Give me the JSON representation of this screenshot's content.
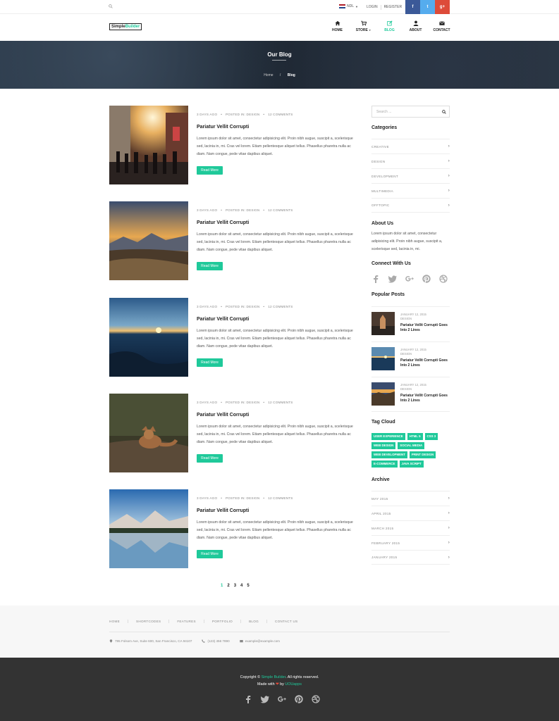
{
  "topbar": {
    "language": "NDL",
    "login": "LOGIN",
    "register": "REGISTER",
    "social": [
      "f",
      "t",
      "g+"
    ]
  },
  "logo": {
    "part1": "Simple",
    "part2": "Builder"
  },
  "menu": [
    {
      "label": "HOME",
      "icon": "home-icon"
    },
    {
      "label": "STORE",
      "icon": "cart-icon"
    },
    {
      "label": "BLOG",
      "icon": "edit-icon"
    },
    {
      "label": "ABOUT",
      "icon": "user-icon"
    },
    {
      "label": "CONTACT",
      "icon": "envelope-icon"
    }
  ],
  "hero": {
    "title": "Our Blog",
    "crumb_home": "Home",
    "crumb_current": "Blog",
    "crumb_sep": "/"
  },
  "posts": [
    {
      "date": "3 DAYS AGO",
      "category": "POSTED IN: DESIGN",
      "comments": "12 COMMENTS",
      "title": "Pariatur Vellit Corrupti",
      "excerpt": "Lorem ipsum dolor sit amet, consectetur adipisicing elit. Proin nibh augue, suscipit a, scelerisque sed, lacinia in, mi. Cras vel lorem. Etiam pellentesque aliquet tellus. Phasellus pharetra nulla ac diam. Nam congue, pede vitae dapibus aliquet.",
      "button": "Read More"
    },
    {
      "date": "3 DAYS AGO",
      "category": "POSTED IN: DESIGN",
      "comments": "12 COMMENTS",
      "title": "Pariatur Vellit Corrupti",
      "excerpt": "Lorem ipsum dolor sit amet, consectetur adipisicing elit. Proin nibh augue, suscipit a, scelerisque sed, lacinia in, mi. Cras vel lorem. Etiam pellentesque aliquet tellus. Phasellus pharetra nulla ac diam. Nam congue, pede vitae dapibus aliquet.",
      "button": "Read More"
    },
    {
      "date": "3 DAYS AGO",
      "category": "POSTED IN: DESIGN",
      "comments": "12 COMMENTS",
      "title": "Pariatur Vellit Corrupti",
      "excerpt": "Lorem ipsum dolor sit amet, consectetur adipisicing elit. Proin nibh augue, suscipit a, scelerisque sed, lacinia in, mi. Cras vel lorem. Etiam pellentesque aliquet tellus. Phasellus pharetra nulla ac diam. Nam congue, pede vitae dapibus aliquet.",
      "button": "Read More"
    },
    {
      "date": "3 DAYS AGO",
      "category": "POSTED IN: DESIGN",
      "comments": "12 COMMENTS",
      "title": "Pariatur Vellit Corrupti",
      "excerpt": "Lorem ipsum dolor sit amet, consectetur adipisicing elit. Proin nibh augue, suscipit a, scelerisque sed, lacinia in, mi. Cras vel lorem. Etiam pellentesque aliquet tellus. Phasellus pharetra nulla ac diam. Nam congue, pede vitae dapibus aliquet.",
      "button": "Read More"
    },
    {
      "date": "3 DAYS AGO",
      "category": "POSTED IN: DESIGN",
      "comments": "12 COMMENTS",
      "title": "Pariatur Vellit Corrupti",
      "excerpt": "Lorem ipsum dolor sit amet, consectetur adipisicing elit. Proin nibh augue, suscipit a, scelerisque sed, lacinia in, mi. Cras vel lorem. Etiam pellentesque aliquet tellus. Phasellus pharetra nulla ac diam. Nam congue, pede vitae dapibus aliquet.",
      "button": "Read More"
    }
  ],
  "pagination": [
    "1",
    "2",
    "3",
    "4",
    "5"
  ],
  "sidebar": {
    "search_placeholder": "Search ...",
    "categories_title": "Categories",
    "categories": [
      "CREATIVE",
      "DESIGN",
      "DEVELOPMENT",
      "MULTIMEDIA",
      "OFFTOPIC"
    ],
    "about_title": "About Us",
    "about_text": "Lorem ipsum dolor sit amet, consectetur adipisicing elit. Proin nibh augue, suscipit a, scelerisque sed, lacinia in, mi.",
    "connect_title": "Connect With Us",
    "popular_title": "Popular Posts",
    "popular": [
      {
        "date": "JANUARY 12, 2015",
        "category": "DESIGN",
        "title": "Pariatur Vellit Corrupti Goes Into 2 Lines"
      },
      {
        "date": "JANUARY 12, 2015",
        "category": "DESIGN",
        "title": "Pariatur Vellit Corrupti Goes Into 2 Lines"
      },
      {
        "date": "JANUARY 12, 2015",
        "category": "DESIGN",
        "title": "Pariatur Vellit Corrupti Goes Into 2 Lines"
      }
    ],
    "tags_title": "Tag Cloud",
    "tags": [
      "USER EXPERIENCE",
      "HTML 5",
      "CSS 3",
      "WEB DESIGN",
      "SOCIAL MEDIA",
      "WEB DEVELOPMENT",
      "PRINT DESIGN",
      "E-COMMERCE",
      "JAVA SCRIPT"
    ],
    "archive_title": "Archive",
    "archive": [
      "MAY 2015",
      "APRIL 2015",
      "MARCH 2015",
      "FEBRUARY 2015",
      "JANUARY 2015"
    ]
  },
  "footer": {
    "nav": [
      "HOME",
      "SHORTCODES",
      "FEATURES",
      "PORTFOLIO",
      "BLOG",
      "CONTACT US"
    ],
    "address": "795 Folsom Ave, Suite 600, San Francisco, CA 94107",
    "phone": "(123) 456 7890",
    "email": "example@example.com",
    "copyright_prefix": "Copyright ©",
    "copyright_brand": "Simple Builder",
    "copyright_suffix": ". All rights reserved.",
    "made_with": "Made with",
    "by": "by",
    "made_by": "UOUapps"
  },
  "colors": {
    "accent": "#1fc99a",
    "footer_dark": "#333333",
    "facebook": "#3b5998",
    "twitter": "#55acee",
    "googleplus": "#dd4b39"
  }
}
